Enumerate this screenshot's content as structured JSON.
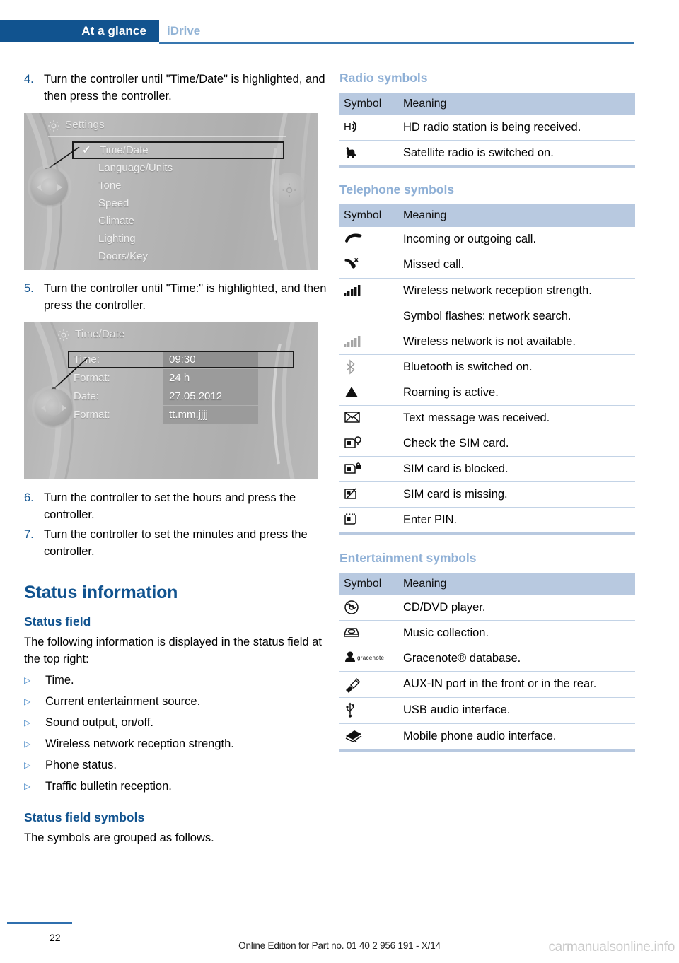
{
  "header": {
    "active_tab": "At a glance",
    "inactive_tab": "iDrive",
    "accent_color": "#11538f"
  },
  "left_column": {
    "steps_top": [
      {
        "num": "4.",
        "text": "Turn the controller until \"Time/Date\" is highlighted, and then press the controller."
      }
    ],
    "settings_screen": {
      "title": "Settings",
      "items": [
        {
          "label": "Time/Date",
          "selected": true,
          "checked": true
        },
        {
          "label": "Language/Units",
          "selected": false,
          "checked": false
        },
        {
          "label": "Tone",
          "selected": false,
          "checked": false
        },
        {
          "label": "Speed",
          "selected": false,
          "checked": false
        },
        {
          "label": "Climate",
          "selected": false,
          "checked": false
        },
        {
          "label": "Lighting",
          "selected": false,
          "checked": false
        },
        {
          "label": "Doors/Key",
          "selected": false,
          "checked": false
        }
      ]
    },
    "steps_mid": [
      {
        "num": "5.",
        "text": "Turn the controller until \"Time:\" is highlighted, and then press the controller."
      }
    ],
    "timedate_screen": {
      "title": "Time/Date",
      "rows": [
        {
          "key": "Time:",
          "value": "09:30",
          "selected": true
        },
        {
          "key": "Format:",
          "value": "24 h",
          "selected": false
        },
        {
          "key": "Date:",
          "value": "27.05.2012",
          "selected": false
        },
        {
          "key": "Format:",
          "value": "tt.mm.jjjj",
          "selected": false
        }
      ]
    },
    "steps_bottom": [
      {
        "num": "6.",
        "text": "Turn the controller to set the hours and press the controller."
      },
      {
        "num": "7.",
        "text": "Turn the controller to set the minutes and press the controller."
      }
    ],
    "status_information_heading": "Status information",
    "status_field_heading": "Status field",
    "status_field_intro": "The following information is displayed in the status field at the top right:",
    "status_field_bullets": [
      "Time.",
      "Current entertainment source.",
      "Sound output, on/off.",
      "Wireless network reception strength.",
      "Phone status.",
      "Traffic bulletin reception."
    ],
    "status_field_symbols_heading": "Status field symbols",
    "status_field_symbols_intro": "The symbols are grouped as follows."
  },
  "right_column": {
    "radio": {
      "heading": "Radio symbols",
      "columns": [
        "Symbol",
        "Meaning"
      ],
      "rows": [
        {
          "icon": "hd-radio-icon",
          "meaning": "HD radio station is being received."
        },
        {
          "icon": "satellite-radio-dog-icon",
          "meaning": "Satellite radio is switched on."
        }
      ]
    },
    "telephone": {
      "heading": "Telephone symbols",
      "columns": [
        "Symbol",
        "Meaning"
      ],
      "rows": [
        {
          "icon": "phone-handset-icon",
          "meaning": "Incoming or outgoing call."
        },
        {
          "icon": "missed-call-icon",
          "meaning": "Missed call."
        },
        {
          "icon": "signal-bars-icon",
          "meaning": "Wireless network reception strength.",
          "meaning2": "Symbol flashes: network search."
        },
        {
          "icon": "signal-bars-gray-icon",
          "meaning": "Wireless network is not available."
        },
        {
          "icon": "bluetooth-icon",
          "meaning": "Bluetooth is switched on."
        },
        {
          "icon": "roaming-triangle-icon",
          "meaning": "Roaming is active."
        },
        {
          "icon": "envelope-icon",
          "meaning": "Text message was received."
        },
        {
          "icon": "sim-check-icon",
          "meaning": "Check the SIM card."
        },
        {
          "icon": "sim-blocked-icon",
          "meaning": "SIM card is blocked."
        },
        {
          "icon": "sim-missing-icon",
          "meaning": "SIM card is missing."
        },
        {
          "icon": "enter-pin-icon",
          "meaning": "Enter PIN."
        }
      ]
    },
    "entertainment": {
      "heading": "Entertainment symbols",
      "columns": [
        "Symbol",
        "Meaning"
      ],
      "rows": [
        {
          "icon": "cd-dvd-icon",
          "meaning": "CD/DVD player."
        },
        {
          "icon": "music-collection-icon",
          "meaning": "Music collection."
        },
        {
          "icon": "gracenote-icon",
          "meaning": "Gracenote® database."
        },
        {
          "icon": "aux-in-plug-icon",
          "meaning": "AUX-IN port in the front or in the rear."
        },
        {
          "icon": "usb-icon",
          "meaning": "USB audio interface."
        },
        {
          "icon": "mobile-phone-audio-icon",
          "meaning": "Mobile phone audio interface."
        }
      ]
    }
  },
  "footer": {
    "page_number": "22",
    "edition_text": "Online Edition for Part no. 01 40 2 956 191 - X/14",
    "watermark": "carmanualsonline.info"
  }
}
